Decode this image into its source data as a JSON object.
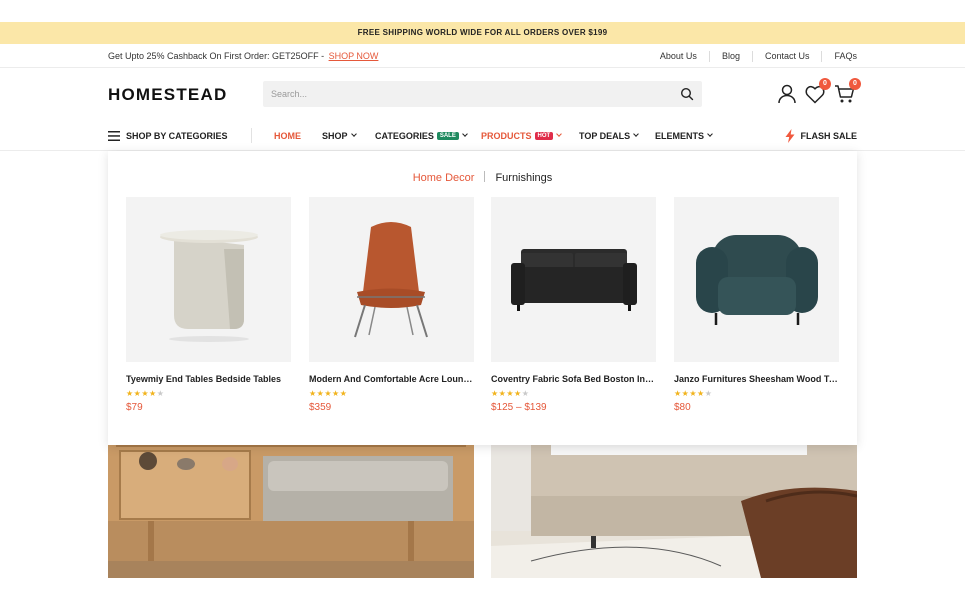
{
  "announcement": "FREE SHIPPING WORLD WIDE FOR ALL ORDERS OVER $199",
  "topbar": {
    "promo_text": "Get Upto 25% Cashback On First Order: GET25OFF - ",
    "promo_link": "SHOP NOW",
    "links": [
      "About Us",
      "Blog",
      "Contact Us",
      "FAQs"
    ]
  },
  "header": {
    "logo": "HOMESTEAD",
    "search_placeholder": "Search...",
    "wishlist_count": "0",
    "cart_count": "0"
  },
  "nav": {
    "categories_button": "SHOP BY CATEGORIES",
    "items": [
      {
        "label": "HOME"
      },
      {
        "label": "SHOP"
      },
      {
        "label": "CATEGORIES",
        "tag": "SALE"
      },
      {
        "label": "PRODUCTS",
        "tag": "HOT"
      },
      {
        "label": "TOP DEALS"
      },
      {
        "label": "ELEMENTS"
      }
    ],
    "flash_sale": "FLASH SALE"
  },
  "dropdown": {
    "tabs": [
      "Home Decor",
      "Furnishings"
    ],
    "products": [
      {
        "name": "Tyewmiy End Tables Bedside Tables",
        "rating": 4,
        "price": "$79"
      },
      {
        "name": "Modern And Comfortable Acre Lounge Chair",
        "rating": 5,
        "price": "$359"
      },
      {
        "name": "Coventry Fabric Sofa Bed Boston Interiors",
        "rating": 4,
        "price": "$125 – $139"
      },
      {
        "name": "Janzo Furnitures Sheesham Wood Two Seater",
        "rating": 4,
        "price": "$80"
      }
    ]
  },
  "colors": {
    "accent": "#e5583a",
    "announcement_bg": "#fbe7a8",
    "star": "#f1b31c",
    "sale_tag": "#1f8a5f",
    "hot_tag": "#e02c4a"
  }
}
